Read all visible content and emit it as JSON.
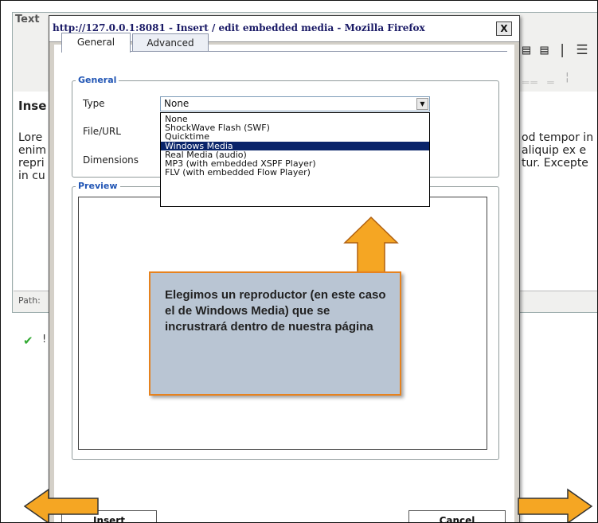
{
  "background_editor": {
    "label": "Text",
    "heading": "Inse",
    "left_text": [
      "Lore",
      "enim",
      "repri",
      "in cu"
    ],
    "right_text": [
      "od tempor in",
      " aliquip ex e",
      "tur. Excepte"
    ],
    "toolbar_icons": "▤ ▤ | ☰",
    "toolbar_icons2": "‗‗ ‗ ¦",
    "path_label": "Path:",
    "status_mark": "✔",
    "status_text": "!"
  },
  "dialog": {
    "title": "http://127.0.0.1:8081 - Insert / edit embedded media - Mozilla Firefox",
    "close": "X",
    "tabs": [
      {
        "label": "General",
        "active": true
      },
      {
        "label": "Advanced",
        "active": false
      }
    ],
    "general_legend": "General",
    "fields": {
      "type_label": "Type",
      "type_value": "None",
      "file_label": "File/URL",
      "dimensions_label": "Dimensions"
    },
    "type_options": [
      "None",
      "ShockWave Flash (SWF)",
      "Quicktime",
      "Windows Media",
      "Real Media (audio)",
      "MP3 (with embedded XSPF Player)",
      "FLV (with embedded Flow Player)"
    ],
    "selected_option": "Windows Media",
    "preview_legend": "Preview",
    "insert_label": "Insert",
    "cancel_label": "Cancel"
  },
  "annotation": {
    "callout_text": "Elegimos un reproductor (en este caso el de Windows Media) que se incrustrará dentro de nuestra página",
    "arrow_color": "#f5a623",
    "callout_bg": "#b9c5d3"
  },
  "colors": {
    "selection": "#0a246a",
    "legend": "#2256b5",
    "title": "#1a1a66"
  }
}
